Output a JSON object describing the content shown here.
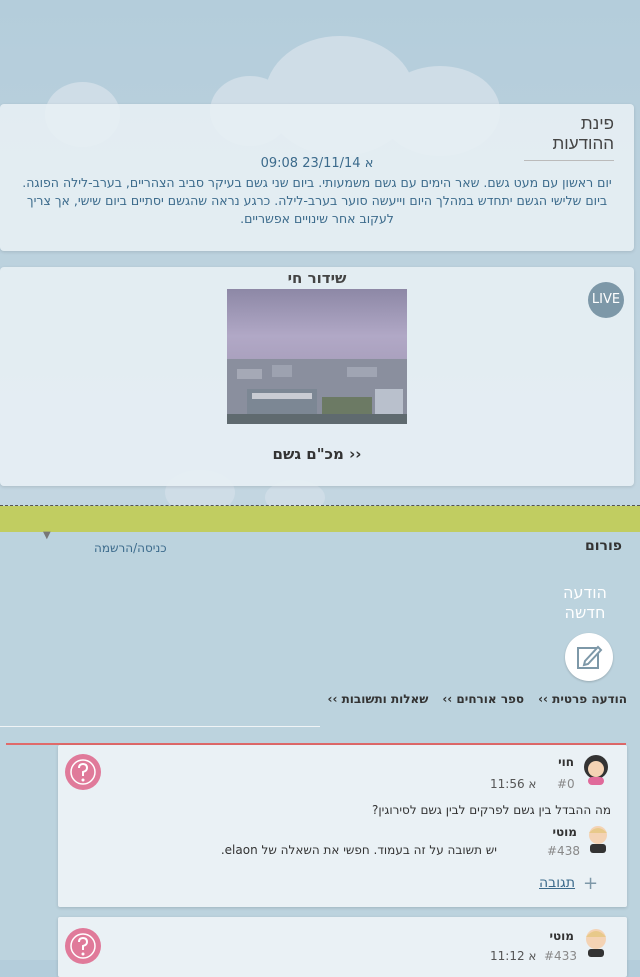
{
  "notice": {
    "title": "פינת ההודעות",
    "meta": "א 23/11/14 09:08",
    "body": "יום ראשון עם מעט גשם. שאר הימים עם גשם משמעותי. ביום שני גשם בעיקר סביב הצהריים, בערב-לילה הפוגה. ביום שלישי הגשם יתחדש במהלך היום וייעשה סוער בערב-לילה. כרגע נראה שהגשם יסתיים ביום שישי, אך צריך לעקוב אחר שינויים אפשריים."
  },
  "live": {
    "title": "שידור חי",
    "badge": "LIVE",
    "link": "מכ\"ם גשם ››"
  },
  "forum": {
    "title": "פורום",
    "login": "כניסה/הרשמה",
    "new_message": "הודעה חדשה",
    "tabs": [
      "הודעה פרטית ››",
      "ספר אורחים ››",
      "שאלות ותשובות ››"
    ]
  },
  "posts": [
    {
      "author": "חוי",
      "number": "#0",
      "time": "א 11:56",
      "text": "מה ההבדל בין גשם לפרקים לבין גשם לסירוגין?",
      "reply_author": "מוטי",
      "reply_number": "#438",
      "reply_text": "יש תשובה על זה בעמוד. חפשי את השאלה של elaon.",
      "reply_label": "תגובה"
    },
    {
      "author": "מוטי",
      "number": "#433",
      "time": "א 11:12"
    }
  ],
  "colors": {
    "green_bar": "#c1cd61",
    "link": "#3c6b8c",
    "question": "#e07a9a"
  }
}
